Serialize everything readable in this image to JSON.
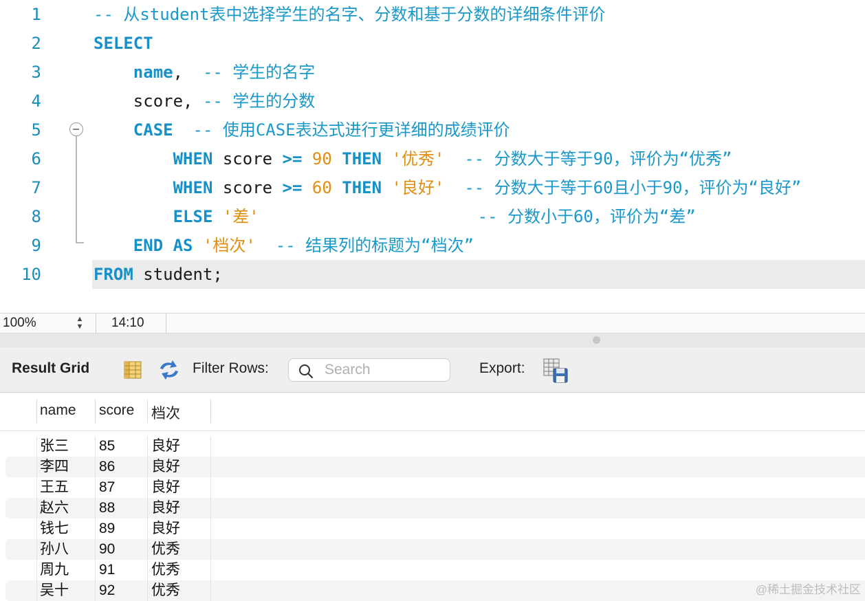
{
  "editor": {
    "lines": [
      {
        "n": "1",
        "tokens": [
          {
            "t": "-- 从student表中选择学生的名字、分数和基于分数的详细条件评价",
            "c": "cm"
          }
        ]
      },
      {
        "n": "2",
        "tokens": [
          {
            "t": "SELECT",
            "c": "kw"
          }
        ]
      },
      {
        "n": "3",
        "tokens": [
          {
            "t": "    "
          },
          {
            "t": "name",
            "c": "kw"
          },
          {
            "t": ",  "
          },
          {
            "t": "-- 学生的名字",
            "c": "cm"
          }
        ]
      },
      {
        "n": "4",
        "tokens": [
          {
            "t": "    score, "
          },
          {
            "t": "-- 学生的分数",
            "c": "cm"
          }
        ]
      },
      {
        "n": "5",
        "tokens": [
          {
            "t": "    "
          },
          {
            "t": "CASE",
            "c": "kw"
          },
          {
            "t": "  "
          },
          {
            "t": "-- 使用CASE表达式进行更详细的成绩评价",
            "c": "cm"
          }
        ]
      },
      {
        "n": "6",
        "tokens": [
          {
            "t": "        "
          },
          {
            "t": "WHEN",
            "c": "kw"
          },
          {
            "t": " score "
          },
          {
            "t": ">=",
            "c": "kw"
          },
          {
            "t": " "
          },
          {
            "t": "90",
            "c": "num"
          },
          {
            "t": " "
          },
          {
            "t": "THEN",
            "c": "kw"
          },
          {
            "t": " "
          },
          {
            "t": "'优秀'",
            "c": "str"
          },
          {
            "t": "  "
          },
          {
            "t": "-- 分数大于等于90，评价为“优秀”",
            "c": "cm"
          }
        ]
      },
      {
        "n": "7",
        "tokens": [
          {
            "t": "        "
          },
          {
            "t": "WHEN",
            "c": "kw"
          },
          {
            "t": " score "
          },
          {
            "t": ">=",
            "c": "kw"
          },
          {
            "t": " "
          },
          {
            "t": "60",
            "c": "num"
          },
          {
            "t": " "
          },
          {
            "t": "THEN",
            "c": "kw"
          },
          {
            "t": " "
          },
          {
            "t": "'良好'",
            "c": "str"
          },
          {
            "t": "  "
          },
          {
            "t": "-- 分数大于等于60且小于90，评价为“良好”",
            "c": "cm"
          }
        ]
      },
      {
        "n": "8",
        "tokens": [
          {
            "t": "        "
          },
          {
            "t": "ELSE",
            "c": "kw"
          },
          {
            "t": " "
          },
          {
            "t": "'差'",
            "c": "str"
          },
          {
            "t": "                      "
          },
          {
            "t": "-- 分数小于60，评价为“差”",
            "c": "cm"
          }
        ]
      },
      {
        "n": "9",
        "tokens": [
          {
            "t": "    "
          },
          {
            "t": "END",
            "c": "kw"
          },
          {
            "t": " "
          },
          {
            "t": "AS",
            "c": "kw"
          },
          {
            "t": " "
          },
          {
            "t": "'档次'",
            "c": "str"
          },
          {
            "t": "  "
          },
          {
            "t": "-- 结果列的标题为“档次”",
            "c": "cm"
          }
        ]
      },
      {
        "n": "10",
        "tokens": [
          {
            "t": "FROM",
            "c": "kw"
          },
          {
            "t": " student;"
          }
        ]
      }
    ]
  },
  "status": {
    "zoom": "100%",
    "cursor": "14:10"
  },
  "toolbar": {
    "result_grid_label": "Result Grid",
    "filter_label": "Filter Rows:",
    "search_placeholder": "Search",
    "export_label": "Export:"
  },
  "grid": {
    "columns": [
      "name",
      "score",
      "档次"
    ],
    "rows": [
      [
        "张三",
        "85",
        "良好"
      ],
      [
        "李四",
        "86",
        "良好"
      ],
      [
        "王五",
        "87",
        "良好"
      ],
      [
        "赵六",
        "88",
        "良好"
      ],
      [
        "钱七",
        "89",
        "良好"
      ],
      [
        "孙八",
        "90",
        "优秀"
      ],
      [
        "周九",
        "91",
        "优秀"
      ],
      [
        "吴十",
        "92",
        "优秀"
      ]
    ]
  },
  "watermark": "@稀土掘金技术社区",
  "colors": {
    "keyword": "#1690c6",
    "comment": "#1a98c9",
    "literal": "#e08e12",
    "line_number": "#1a8cb8"
  }
}
